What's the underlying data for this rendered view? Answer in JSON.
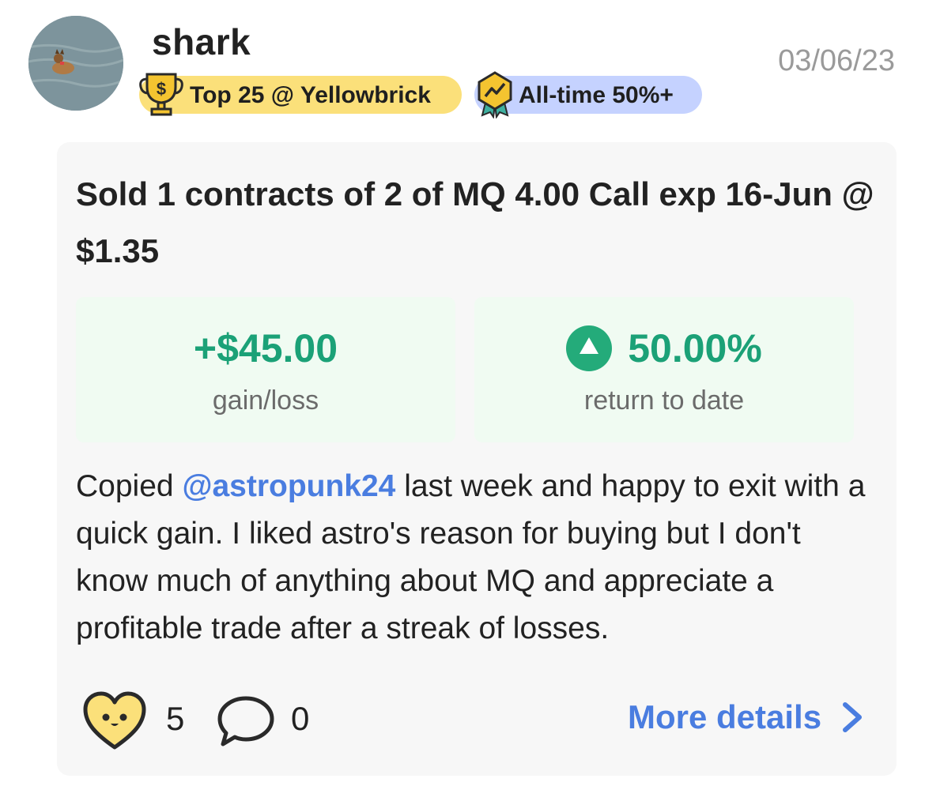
{
  "post": {
    "username": "shark",
    "date": "03/06/23",
    "avatar_icon": "dog-in-water-photo",
    "badges": [
      {
        "label": "Top 25 @ Yellowbrick",
        "icon": "trophy-dollar-icon",
        "color": "#fbe07a"
      },
      {
        "label": "All-time 50%+",
        "icon": "chart-medal-icon",
        "color": "#c5d2ff"
      }
    ]
  },
  "trade": {
    "title": "Sold 1 contracts of 2 of MQ 4.00 Call exp 16-Jun @ $1.35",
    "gain": {
      "value": "+$45.00",
      "label": "gain/loss"
    },
    "return": {
      "value": "50.00%",
      "label": "return to date",
      "icon": "up-arrow-circle-icon"
    },
    "accent_green": "#1ba177"
  },
  "comment": {
    "before": "Copied ",
    "mention": "@astropunk24",
    "after": " last week and happy to exit with a quick gain. I liked astro's reason for buying but I don't know much of anything about MQ and appreciate a profitable trade after a streak of losses."
  },
  "footer": {
    "likes": "5",
    "comments": "0",
    "more_label": "More details",
    "link_color": "#4a7de0"
  }
}
